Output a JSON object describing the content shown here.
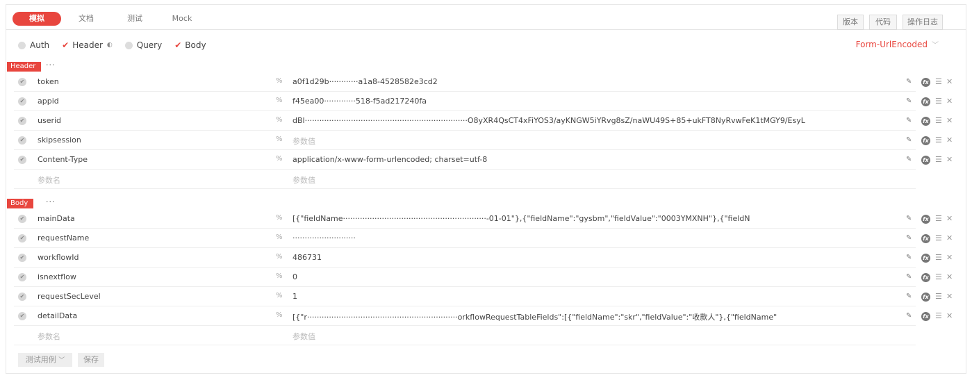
{
  "tabs": [
    {
      "label": "模拟",
      "active": true
    },
    {
      "label": "文档"
    },
    {
      "label": "测试"
    },
    {
      "label": "Mock"
    }
  ],
  "toolbar": {
    "version_label": "版本",
    "code_label": "代码",
    "log_label": "操作日志"
  },
  "options": {
    "auth": "Auth",
    "header": "Header",
    "query": "Query",
    "body": "Body"
  },
  "encoding": "Form-UrlEncoded",
  "header_section": {
    "label": "Header",
    "rows": [
      {
        "key": "token",
        "value": "a0f1d29b············a1a8-4528582e3cd2"
      },
      {
        "key": "appid",
        "value": "f45ea00·············518-f5ad217240fa"
      },
      {
        "key": "userid",
        "value": "dBl···································································O8yXR4QsCT4xFiYOS3/ayKNGW5iYRvg8sZ/naWU49S+85+ukFT8NyRvwFeK1tMGY9/EsyL"
      },
      {
        "key": "skipsession",
        "value": "参数值",
        "placeholder": true
      },
      {
        "key": "Content-Type",
        "value": "application/x-www-form-urlencoded; charset=utf-8"
      }
    ],
    "empty_key": "参数名",
    "empty_value": "参数值"
  },
  "body_section": {
    "label": "Body",
    "rows": [
      {
        "key": "mainData",
        "value": "[{\"fieldName···························································-01-01\"},{\"fieldName\":\"gysbm\",\"fieldValue\":\"0003YMXNH\"},{\"fieldN"
      },
      {
        "key": "requestName",
        "value": "··························"
      },
      {
        "key": "workflowId",
        "value": "486731"
      },
      {
        "key": "isnextflow",
        "value": "0"
      },
      {
        "key": "requestSecLevel",
        "value": "1"
      },
      {
        "key": "detailData",
        "value": "[{\"r······························································orkflowRequestTableFields\":[{\"fieldName\":\"skr\",\"fieldValue\":\"收款人\"},{\"fieldName\""
      }
    ],
    "empty_key": "参数名",
    "empty_value": "参数值"
  },
  "footer": {
    "test_case_label": "测试用例",
    "save_label": "保存"
  },
  "colors": {
    "accent": "#e8463e"
  }
}
